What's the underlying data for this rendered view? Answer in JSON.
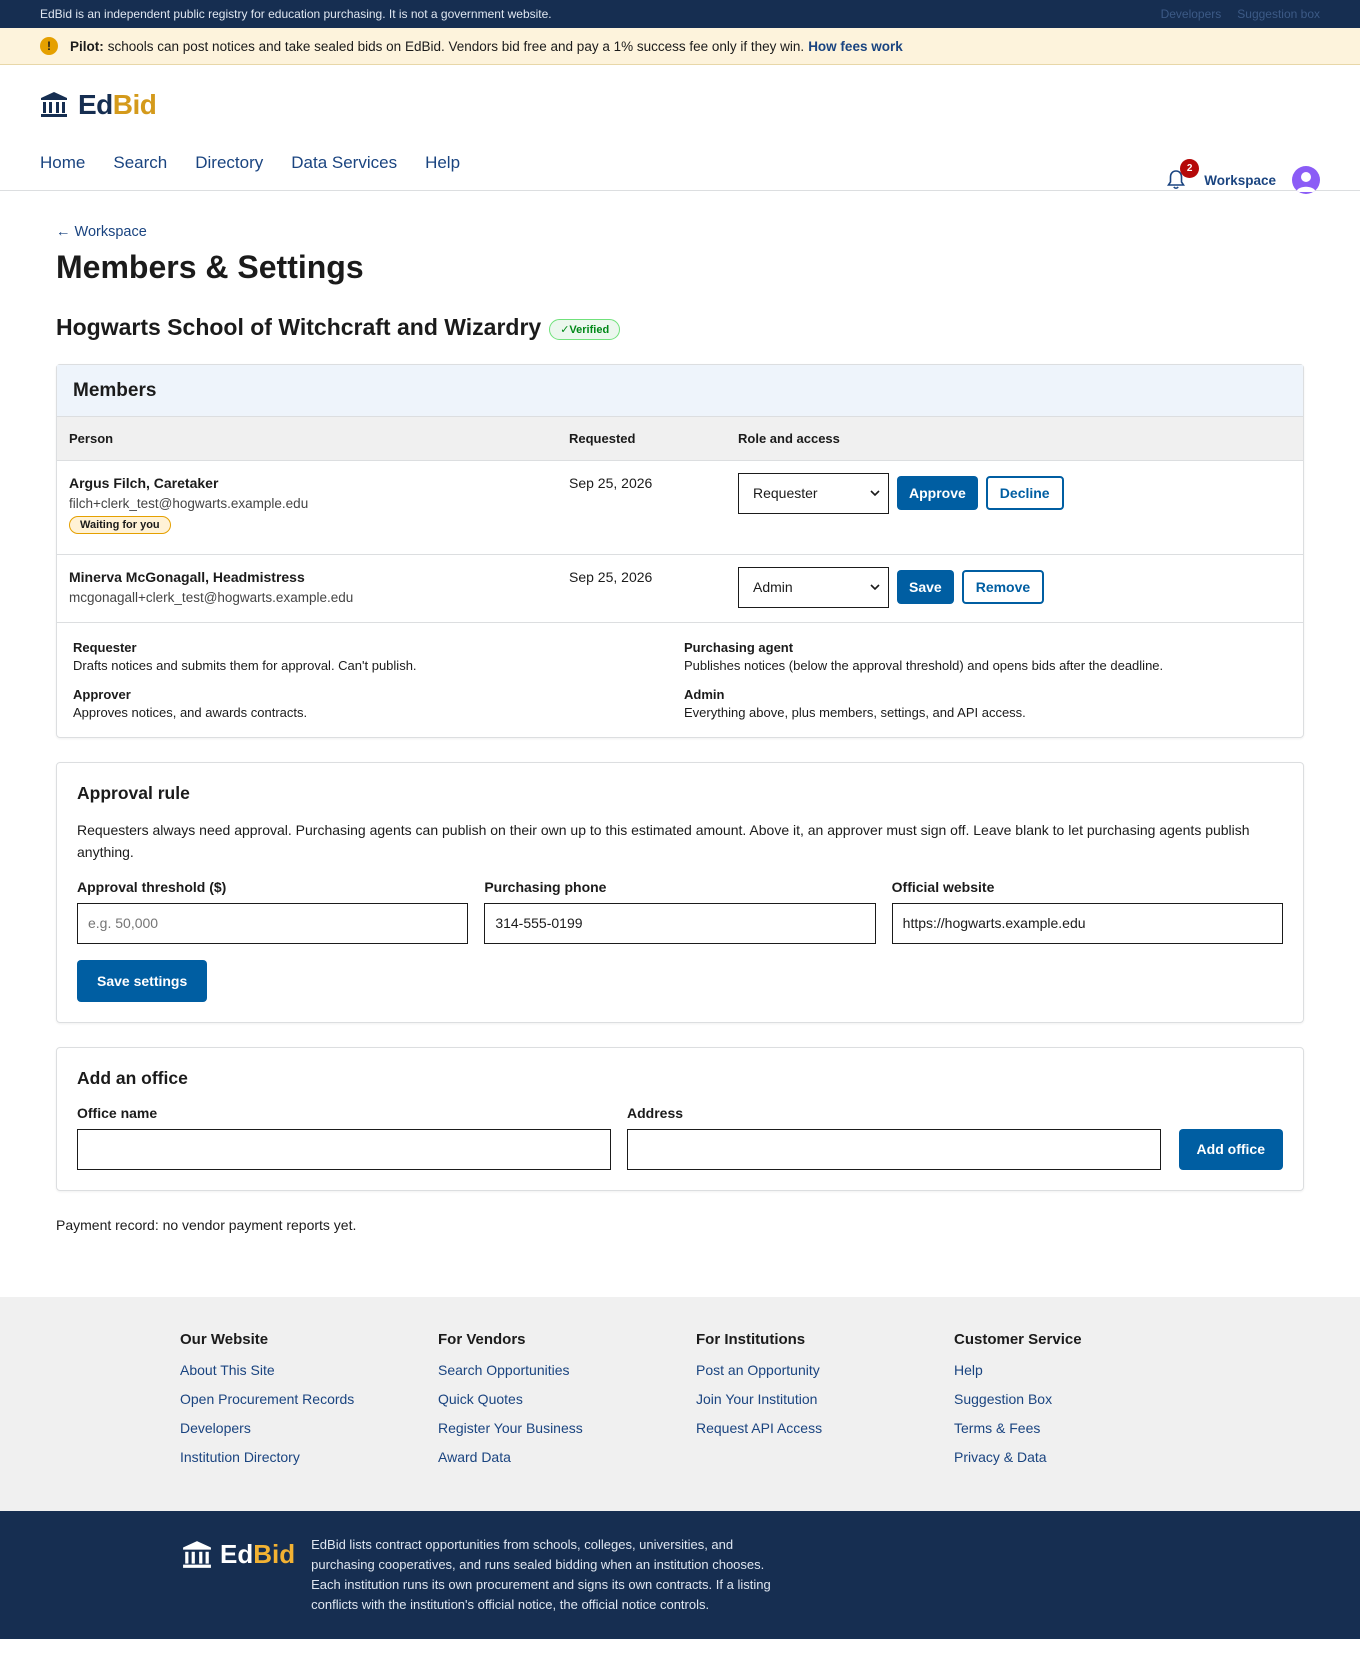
{
  "topbar": {
    "notice": "EdBid is an independent public registry for education purchasing. It is not a government website.",
    "links": [
      "Developers",
      "Suggestion box"
    ]
  },
  "banner": {
    "label": "Pilot:",
    "text": "schools can post notices and take sealed bids on EdBid. Vendors bid free and pay a 1% success fee only if they win.",
    "link": "How fees work"
  },
  "header": {
    "logo_ed": "Ed",
    "logo_bid": "Bid",
    "notifications_count": "2",
    "workspace_label": "Workspace",
    "nav": [
      "Home",
      "Search",
      "Directory",
      "Data Services",
      "Help"
    ]
  },
  "page": {
    "back_label": "← Workspace",
    "title": "Members & Settings",
    "institution": "Hogwarts School of Witchcraft and Wizardry",
    "verified_badge": "✓Verified",
    "payment_record": "Payment record: no vendor payment reports yet."
  },
  "members": {
    "heading": "Members",
    "columns": [
      "Person",
      "Requested",
      "Role and access"
    ],
    "rows": [
      {
        "name": "Argus Filch, Caretaker",
        "email": "filch+clerk_test@hogwarts.example.edu",
        "badge": "Waiting for you",
        "requested": "Sep 25, 2026",
        "role": "Requester",
        "primary_action": "Approve",
        "secondary_action": "Decline"
      },
      {
        "name": "Minerva McGonagall, Headmistress",
        "email": "mcgonagall+clerk_test@hogwarts.example.edu",
        "requested": "Sep 25, 2026",
        "role": "Admin",
        "primary_action": "Save",
        "secondary_action": "Remove"
      }
    ],
    "roles_legend": [
      {
        "title": "Requester",
        "desc": "Drafts notices and submits them for approval. Can't publish."
      },
      {
        "title": "Purchasing agent",
        "desc": "Publishes notices (below the approval threshold) and opens bids after the deadline."
      },
      {
        "title": "Approver",
        "desc": "Approves notices, and awards contracts."
      },
      {
        "title": "Admin",
        "desc": "Everything above, plus members, settings, and API access."
      }
    ]
  },
  "approval": {
    "heading": "Approval rule",
    "desc": "Requesters always need approval. Purchasing agents can publish on their own up to this estimated amount. Above it, an approver must sign off. Leave blank to let purchasing agents publish anything.",
    "threshold_label": "Approval threshold ($)",
    "threshold_placeholder": "e.g. 50,000",
    "phone_label": "Purchasing phone",
    "phone_value": "314-555-0199",
    "website_label": "Official website",
    "website_value": "https://hogwarts.example.edu",
    "save_label": "Save settings"
  },
  "office": {
    "heading": "Add an office",
    "name_label": "Office name",
    "address_label": "Address",
    "add_label": "Add office"
  },
  "footer": {
    "columns": [
      {
        "heading": "Our Website",
        "links": [
          "About This Site",
          "Open Procurement Records",
          "Developers",
          "Institution Directory"
        ]
      },
      {
        "heading": "For Vendors",
        "links": [
          "Search Opportunities",
          "Quick Quotes",
          "Register Your Business",
          "Award Data"
        ]
      },
      {
        "heading": "For Institutions",
        "links": [
          "Post an Opportunity",
          "Join Your Institution",
          "Request API Access"
        ]
      },
      {
        "heading": "Customer Service",
        "links": [
          "Help",
          "Suggestion Box",
          "Terms & Fees",
          "Privacy & Data"
        ]
      }
    ],
    "logo_ed": "Ed",
    "logo_bid": "Bid",
    "about": "EdBid lists contract opportunities from schools, colleges, universities, and purchasing cooperatives, and runs sealed bidding when an institution chooses. Each institution runs its own procurement and signs its own contracts. If a listing conflicts with the institution's official notice, the official notice controls."
  },
  "colors": {
    "navy": "#162e51",
    "link": "#1a4480",
    "primary": "#005ea2",
    "accent_gold": "#d49a1b",
    "badge_red": "#b50909"
  }
}
